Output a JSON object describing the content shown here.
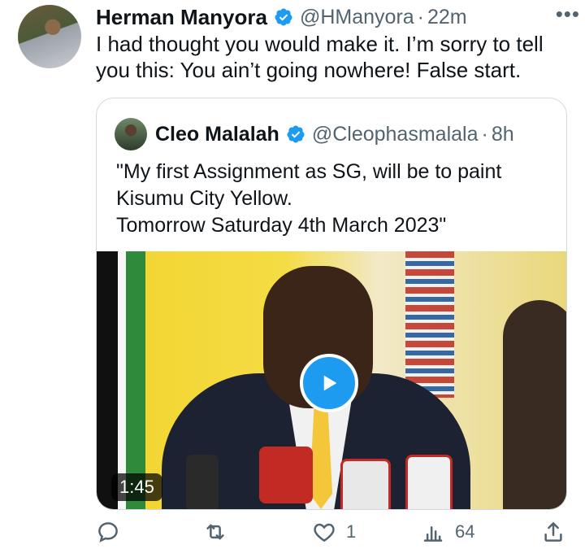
{
  "tweet": {
    "author_name": "Herman Manyora",
    "handle": "@HManyora",
    "separator": "·",
    "time": "22m",
    "text": "I had thought you would make it. I’m sorry to tell you this: You ain’t going nowhere! False start."
  },
  "quoted_tweet": {
    "author_name": "Cleo Malalah",
    "handle": "@Cleophasmalala",
    "separator": "·",
    "time": "8h",
    "text": "\"My first Assignment as SG, will be to paint Kisumu City Yellow.\n Tomorrow Saturday 4th March 2023\"",
    "video_duration": "1:45"
  },
  "actions": {
    "reply_count": "",
    "retweet_count": "",
    "like_count": "1",
    "views_count": "64"
  },
  "icons": {
    "more": "more-dots-icon",
    "verified": "verified-badge-icon",
    "play": "play-icon",
    "reply": "reply-icon",
    "retweet": "retweet-icon",
    "like": "heart-icon",
    "views": "views-icon",
    "share": "share-icon"
  },
  "colors": {
    "accent": "#1d9bf0",
    "text": "#0f1419",
    "secondary": "#536471",
    "border": "#cfd9de"
  }
}
